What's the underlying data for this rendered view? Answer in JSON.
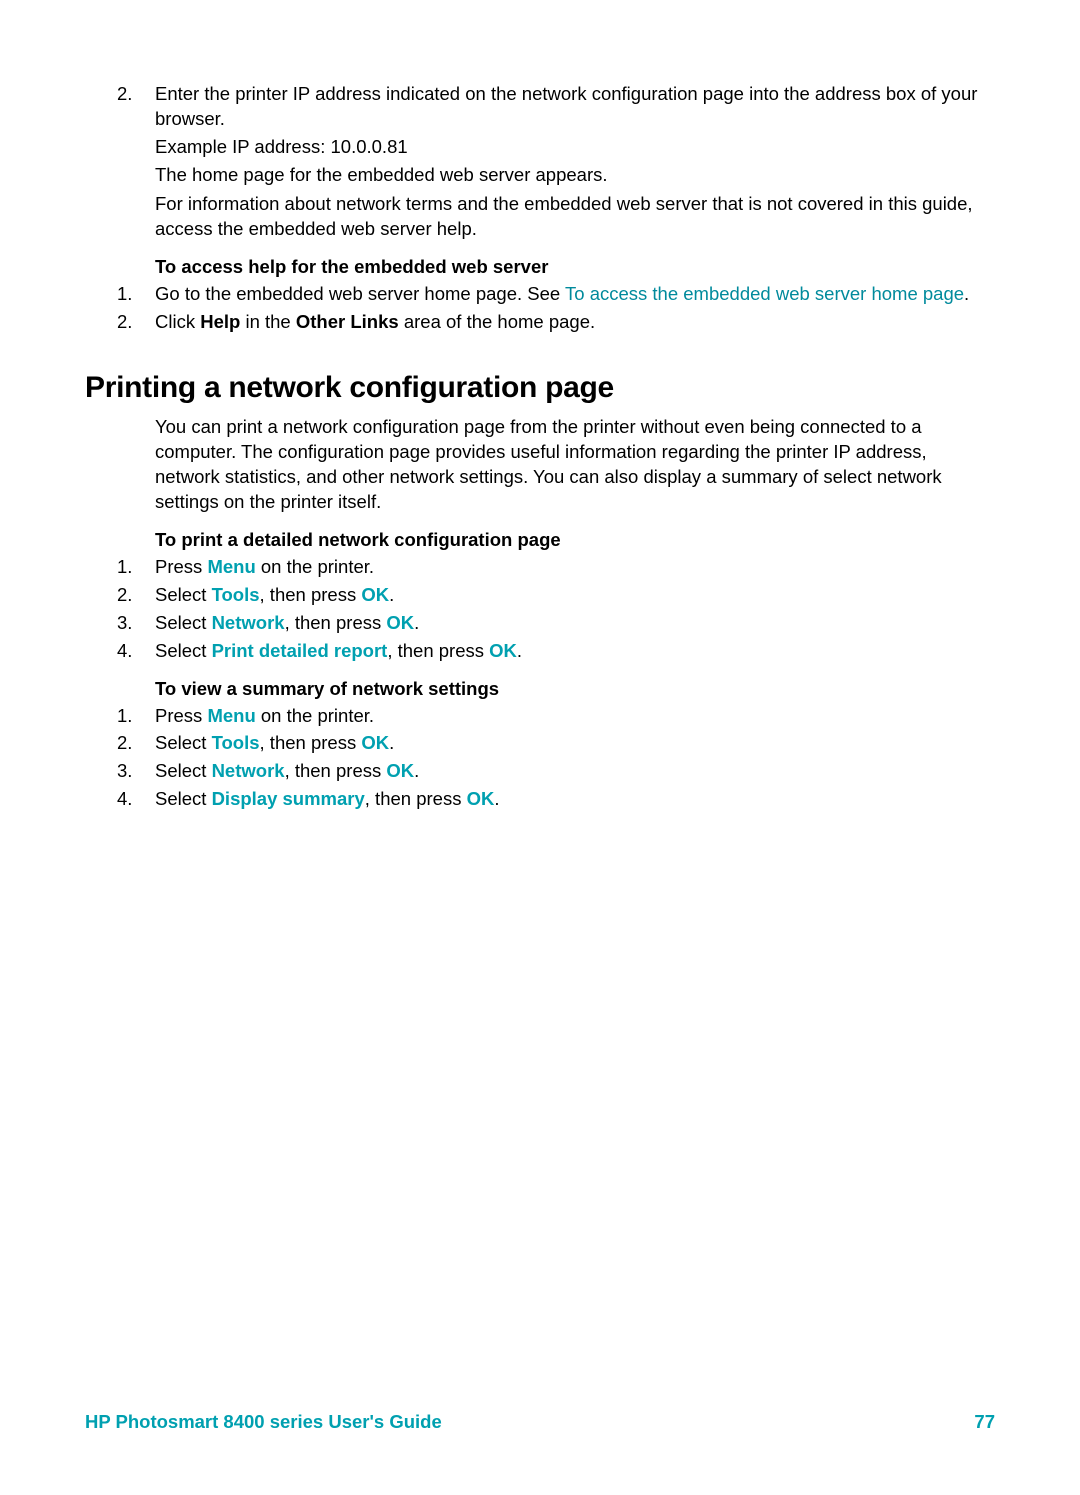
{
  "intro_list": {
    "item2_num": "2.",
    "item2_line1": "Enter the printer IP address indicated on the network configuration page into the address box of your browser.",
    "item2_line2": "Example IP address: 10.0.0.81",
    "item2_line3": "The home page for the embedded web server appears."
  },
  "intro_para": "For information about network terms and the embedded web server that is not covered in this guide, access the embedded web server help.",
  "access_help": {
    "heading": "To access help for the embedded web server",
    "item1_num": "1.",
    "item1_prefix": "Go to the embedded web server home page. See ",
    "item1_link": "To access the embedded web server home page",
    "item1_suffix": ".",
    "item2_num": "2.",
    "item2_prefix": "Click ",
    "item2_bold": "Help",
    "item2_mid": " in the ",
    "item2_bold2": "Other Links",
    "item2_suffix": " area of the home page."
  },
  "section_heading": "Printing a network configuration page",
  "section_intro": "You can print a network configuration page from the printer without even being connected to a computer. The configuration page provides useful information regarding the printer IP address, network statistics, and other network settings. You can also display a summary of select network settings on the printer itself.",
  "print_detailed": {
    "heading": "To print a detailed network configuration page",
    "n1": "1.",
    "n2": "2.",
    "n3": "3.",
    "n4": "4.",
    "i1a": "Press ",
    "i1b": "Menu",
    "i1c": " on the printer.",
    "i2a": "Select ",
    "i2b": "Tools",
    "i2c": ", then press ",
    "i2d": "OK",
    "i2e": ".",
    "i3a": "Select ",
    "i3b": "Network",
    "i3c": ", then press ",
    "i3d": "OK",
    "i3e": ".",
    "i4a": "Select ",
    "i4b": "Print detailed report",
    "i4c": ", then press ",
    "i4d": "OK",
    "i4e": "."
  },
  "view_summary": {
    "heading": "To view a summary of network settings",
    "n1": "1.",
    "n2": "2.",
    "n3": "3.",
    "n4": "4.",
    "i1a": "Press ",
    "i1b": "Menu",
    "i1c": " on the printer.",
    "i2a": "Select ",
    "i2b": "Tools",
    "i2c": ", then press ",
    "i2d": "OK",
    "i2e": ".",
    "i3a": "Select ",
    "i3b": "Network",
    "i3c": ", then press ",
    "i3d": "OK",
    "i3e": ".",
    "i4a": "Select ",
    "i4b": "Display summary",
    "i4c": ", then press ",
    "i4d": "OK",
    "i4e": "."
  },
  "footer": {
    "left": "HP Photosmart 8400 series User's Guide",
    "right": "77"
  }
}
